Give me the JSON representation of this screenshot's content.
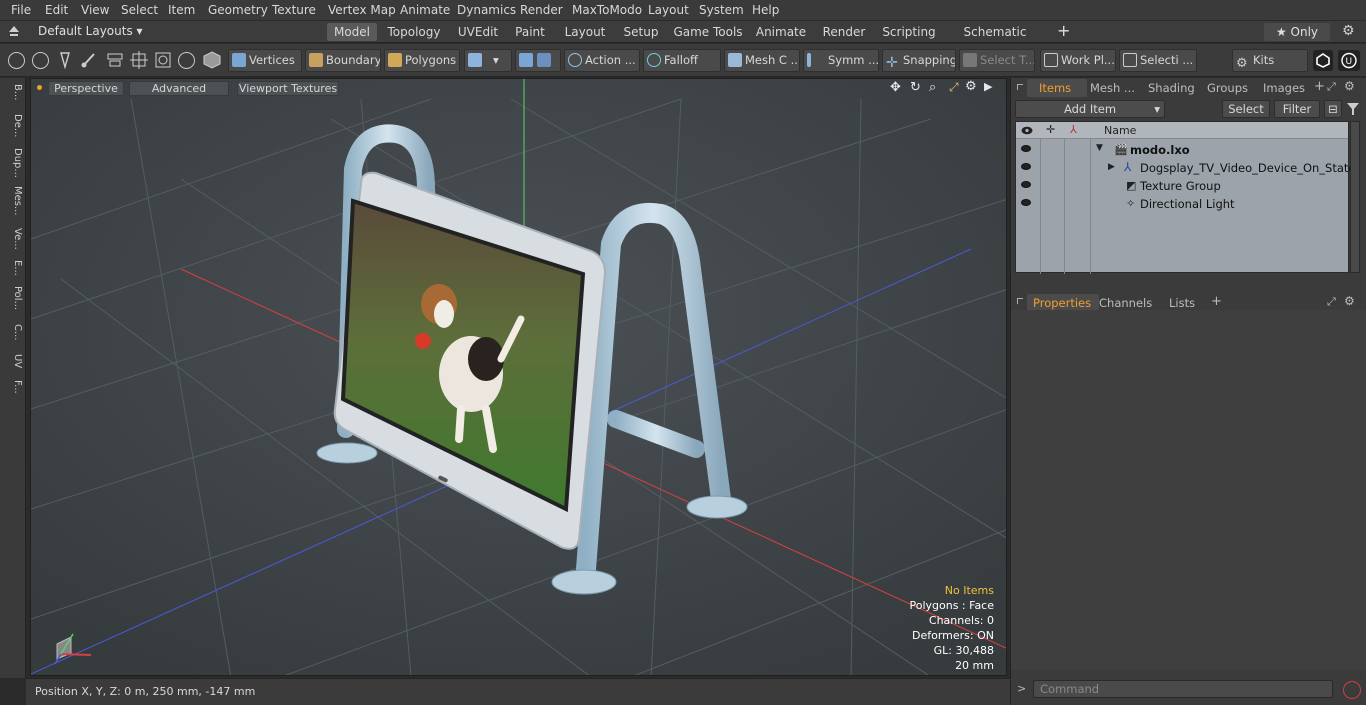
{
  "menu": [
    "File",
    "Edit",
    "View",
    "Select",
    "Item",
    "Geometry",
    "Texture",
    "Vertex Map",
    "Animate",
    "Dynamics",
    "Render",
    "MaxToModo",
    "Layout",
    "System",
    "Help"
  ],
  "layout": {
    "selector": "Default Layouts ▾",
    "tabs": [
      "Model",
      "Topology",
      "UVEdit",
      "Paint",
      "Layout",
      "Setup",
      "Game Tools",
      "Animate",
      "Render",
      "Scripting",
      "Schematic Fusion"
    ],
    "active_tab": "Model",
    "plus": "+",
    "only": "★  Only",
    "gear": "⚙"
  },
  "toolbar": {
    "vertices": "Vertices",
    "boundary": "Boundary",
    "polygons": "Polygons",
    "action": "Action",
    "action_more": "...",
    "falloff": "Falloff",
    "meshc": "Mesh C ...",
    "symm": "Symm ...",
    "snapping": "Snapping",
    "select_t": "Select T...",
    "workpl": "Work Pl...",
    "selecti": "Selecti ...",
    "kits": "Kits"
  },
  "left_strip": [
    "B...",
    "De...",
    "Dup...",
    "Mes...",
    "Ve...",
    "E...",
    "Pol...",
    "C...",
    "UV",
    "F..."
  ],
  "viewport": {
    "perspective": "Perspective",
    "advanced": "Advanced",
    "textures": "Viewport Textures",
    "info": {
      "no_items": "No Items",
      "polygons": "Polygons : Face",
      "channels": "Channels: 0",
      "deformers": "Deformers: ON",
      "gl": "GL: 30,488",
      "scale": "20 mm"
    }
  },
  "status": {
    "position": "Position X, Y, Z:   0 m, 250 mm, -147 mm"
  },
  "right": {
    "tabs": [
      "Items",
      "Mesh ...",
      "Shading",
      "Groups",
      "Images"
    ],
    "active_tab": "Items",
    "add_item": "Add Item",
    "select": "Select",
    "filter": "Filter",
    "col_name": "Name",
    "items": [
      {
        "label": "modo.lxo",
        "bold": true
      },
      {
        "label": "Dogsplay_TV_Video_Device_On_State",
        "bold": false
      },
      {
        "label": "Texture Group",
        "bold": false
      },
      {
        "label": "Directional Light",
        "bold": false
      }
    ],
    "prop_tabs": [
      "Properties",
      "Channels",
      "Lists"
    ],
    "prop_active": "Properties",
    "command_placeholder": "Command"
  },
  "colors": {
    "accent": "#f0a030",
    "viewport_bg": "#3f4447",
    "info_highlight": "#f0c040"
  }
}
